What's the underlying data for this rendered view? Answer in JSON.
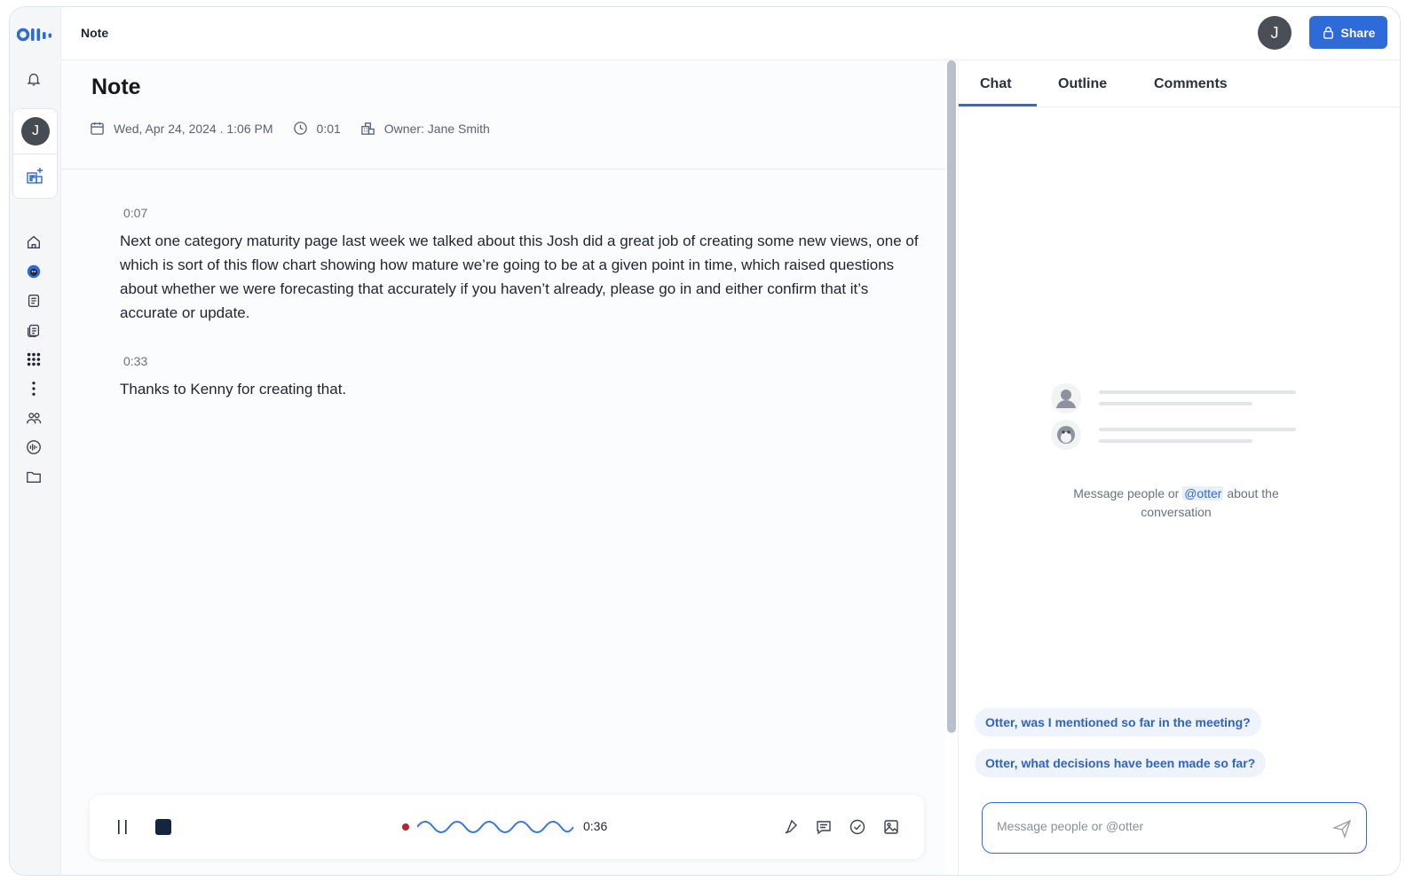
{
  "header": {
    "breadcrumb": "Note",
    "user_initial": "J",
    "share_label": "Share",
    "accent_color": "#2f6ad9"
  },
  "rail": {
    "user_initial": "J",
    "icons": [
      "bell-icon",
      "add-app-icon",
      "home-icon",
      "otter-icon",
      "notes-icon",
      "my-notes-icon",
      "apps-grid-icon",
      "more-vertical-icon",
      "people-icon",
      "audio-icon",
      "folder-icon"
    ]
  },
  "note": {
    "title": "Note",
    "date": "Wed, Apr 24, 2024 . 1:06 PM",
    "duration": "0:01",
    "owner": "Owner: Jane Smith",
    "segments": [
      {
        "timestamp": "0:07",
        "text": "Next one category maturity page last week we talked about this Josh did a great job of creating some new views, one of which is sort of this flow chart showing how mature we’re going to be at a given point in time, which raised questions about whether we were forecasting that accurately if you haven’t already, please go in and either confirm that it’s accurate or update."
      },
      {
        "timestamp": "0:33",
        "text": "Thanks to Kenny for creating that."
      }
    ]
  },
  "player": {
    "elapsed": "0:36",
    "recording_color": "#b3262a"
  },
  "panel": {
    "tabs": [
      {
        "label": "Chat",
        "active": true
      },
      {
        "label": "Outline",
        "active": false
      },
      {
        "label": "Comments",
        "active": false
      }
    ],
    "empty_prefix": "Message people or",
    "empty_mention": "@otter",
    "empty_suffix": "about the conversation",
    "suggestions": [
      "Otter, was I mentioned so far in the meeting?",
      "Otter, what decisions have been made so far?"
    ],
    "input_value": "",
    "input_placeholder": "Message people or @otter"
  }
}
